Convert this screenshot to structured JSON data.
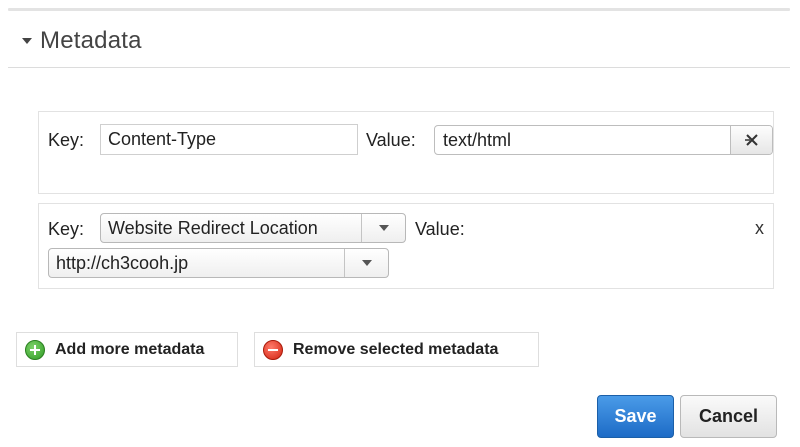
{
  "section": {
    "title": "Metadata"
  },
  "rows": [
    {
      "key_label": "Key:",
      "key_value": "Content-Type",
      "value_label": "Value:",
      "value_value": "text/html",
      "clear_icon": "clear-x-icon"
    },
    {
      "key_label": "Key:",
      "key_value": "Website Redirect Location",
      "value_label": "Value:",
      "value_value": "http://ch3cooh.jp",
      "remove_label": "x"
    }
  ],
  "actions": {
    "add_label": "Add more metadata",
    "add_icon": "add-circle-icon",
    "add_icon_color": "#2e9a23",
    "remove_label": "Remove selected metadata",
    "remove_icon": "remove-circle-icon",
    "remove_icon_color": "#d2220f"
  },
  "footer": {
    "save_label": "Save",
    "cancel_label": "Cancel",
    "save_color": "#1d6bc6"
  }
}
